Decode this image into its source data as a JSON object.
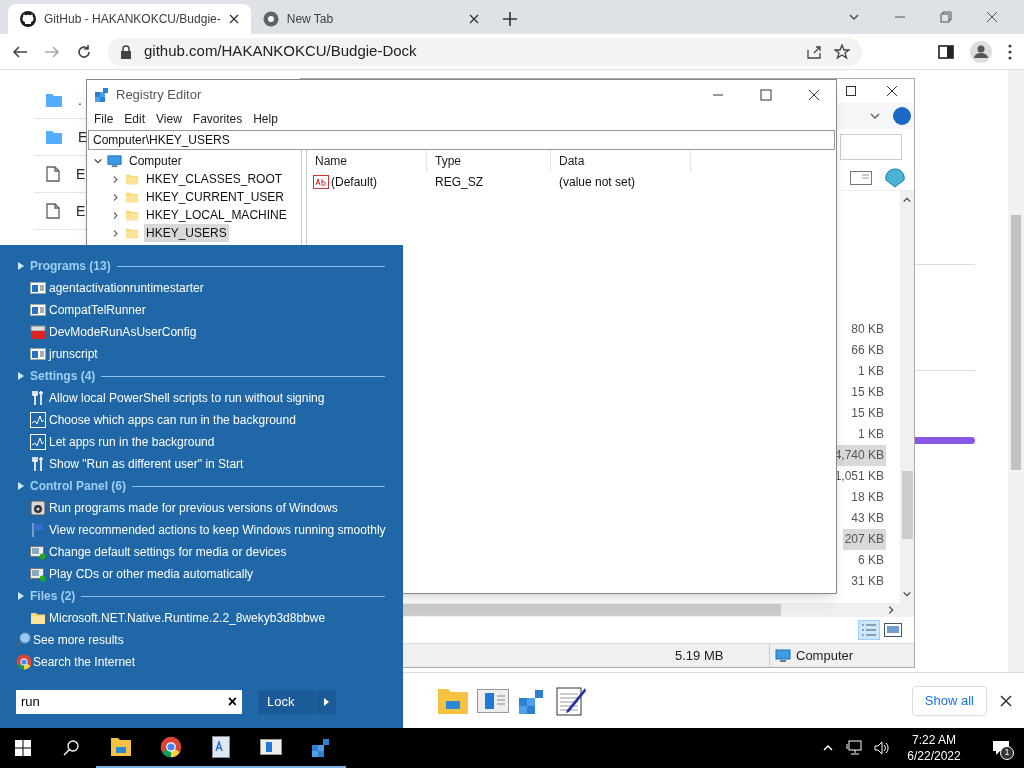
{
  "browser": {
    "tabs": [
      {
        "title": "GitHub - HAKANKOKCU/Budgie-",
        "kind": "github",
        "selected": true
      },
      {
        "title": "New Tab",
        "kind": "chrome",
        "selected": false
      }
    ],
    "url": "github.com/HAKANKOKCU/Budgie-Dock"
  },
  "page": {
    "file_rows": [
      {
        "kind": "folder",
        "name": "."
      },
      {
        "kind": "folder",
        "name": "E"
      },
      {
        "kind": "file",
        "name": "E"
      },
      {
        "kind": "file",
        "name": "E"
      }
    ]
  },
  "explorer": {
    "sizes": [
      {
        "text": "80 KB",
        "selected": false
      },
      {
        "text": "66 KB",
        "selected": false
      },
      {
        "text": "1 KB",
        "selected": false
      },
      {
        "text": "15 KB",
        "selected": false
      },
      {
        "text": "15 KB",
        "selected": false
      },
      {
        "text": "1 KB",
        "selected": false
      },
      {
        "text": "4,740 KB",
        "selected": true
      },
      {
        "text": "1,051 KB",
        "selected": false
      },
      {
        "text": "18 KB",
        "selected": false
      },
      {
        "text": "43 KB",
        "selected": false
      },
      {
        "text": "207 KB",
        "selected": true
      },
      {
        "text": "6 KB",
        "selected": false
      },
      {
        "text": "31 KB",
        "selected": false
      }
    ],
    "status_size": "5.19 MB",
    "status_location": "Computer"
  },
  "registry": {
    "title": "Registry Editor",
    "menu": [
      "File",
      "Edit",
      "View",
      "Favorites",
      "Help"
    ],
    "address": "Computer\\HKEY_USERS",
    "tree": {
      "label": "Computer",
      "expanded": true,
      "children": [
        {
          "label": "HKEY_CLASSES_ROOT",
          "selected": false
        },
        {
          "label": "HKEY_CURRENT_USER",
          "selected": false
        },
        {
          "label": "HKEY_LOCAL_MACHINE",
          "selected": false
        },
        {
          "label": "HKEY_USERS",
          "selected": true
        }
      ]
    },
    "columns": [
      "Name",
      "Type",
      "Data"
    ],
    "values": [
      {
        "name": "(Default)",
        "type": "REG_SZ",
        "data": "(value not set)"
      }
    ]
  },
  "start_menu": {
    "groups": [
      {
        "title": "Programs (13)",
        "items": [
          {
            "label": "agentactivationruntimestarter",
            "kind": "app"
          },
          {
            "label": "CompatTelRunner",
            "kind": "app"
          },
          {
            "label": "DevModeRunAsUserConfig",
            "kind": "toolbox"
          },
          {
            "label": "jrunscript",
            "kind": "app"
          }
        ]
      },
      {
        "title": "Settings (4)",
        "items": [
          {
            "label": "Allow local PowerShell scripts to run without signing",
            "kind": "tools"
          },
          {
            "label": "Choose which apps can run in the background",
            "kind": "chart"
          },
          {
            "label": "Let apps run in the background",
            "kind": "chart"
          },
          {
            "label": "Show \"Run as different user\" in Start",
            "kind": "tools"
          }
        ]
      },
      {
        "title": "Control Panel (6)",
        "items": [
          {
            "label": "Run programs made for previous versions of Windows",
            "kind": "disc"
          },
          {
            "label": "View recommended actions to keep Windows running smoothly",
            "kind": "flag"
          },
          {
            "label": "Change default settings for media or devices",
            "kind": "media"
          },
          {
            "label": "Play CDs or other media automatically",
            "kind": "media"
          }
        ]
      },
      {
        "title": "Files (2)",
        "items": [
          {
            "label": "Microsoft.NET.Native.Runtime.2.2_8wekyb3d8bbwe",
            "kind": "folder"
          }
        ]
      }
    ],
    "links": [
      {
        "label": "See more results",
        "kind": "search"
      },
      {
        "label": "Search the Internet",
        "kind": "chrome"
      }
    ],
    "search_value": "run",
    "clear": "×",
    "power_button": "Lock"
  },
  "download_shelf": {
    "show_all": "Show all"
  },
  "taskbar": {
    "time": "7:22 AM",
    "date": "6/22/2022",
    "notifications": "1"
  }
}
